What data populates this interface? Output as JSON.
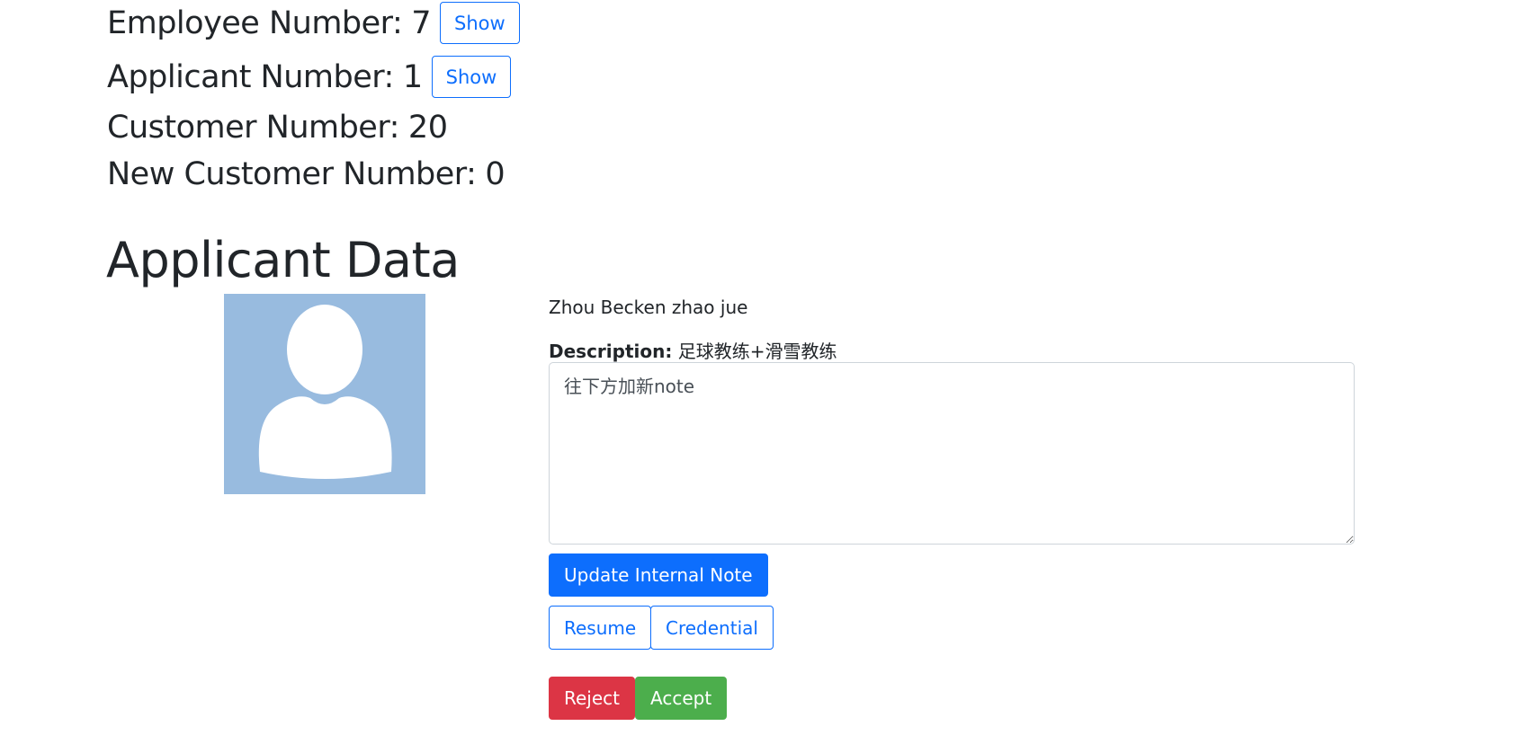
{
  "stats": {
    "employee": {
      "label": "Employee Number:",
      "value": "7",
      "button": "Show"
    },
    "applicant": {
      "label": "Applicant Number:",
      "value": "1",
      "button": "Show"
    },
    "customer": {
      "label": "Customer Number:",
      "value": "20"
    },
    "new_customer": {
      "label": "New Customer Number:",
      "value": "0"
    }
  },
  "section": {
    "title": "Applicant Data"
  },
  "applicant": {
    "name": "Zhou Becken zhao jue",
    "description_label": "Description:",
    "description": "足球教练+滑雪教练",
    "note_value": "往下方加新note"
  },
  "actions": {
    "update_note": "Update Internal Note",
    "resume": "Resume",
    "credential": "Credential",
    "reject": "Reject",
    "accept": "Accept"
  },
  "colors": {
    "primary": "#0d6efd",
    "danger": "#dc3545",
    "success": "#4cae4c",
    "avatar_bg": "#98bbdf"
  },
  "icons": {
    "avatar": "user-silhouette-icon"
  }
}
